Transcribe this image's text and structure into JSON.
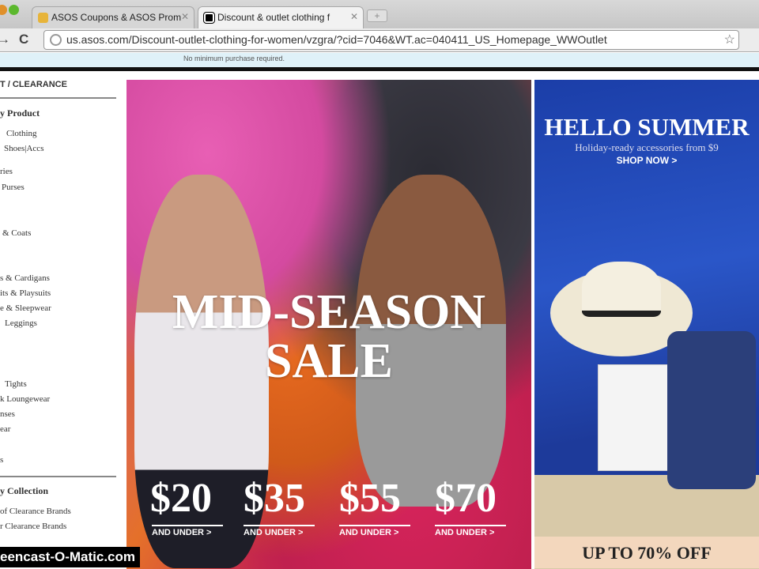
{
  "browser": {
    "tabs": [
      {
        "label": "ASOS Coupons & ASOS Prom",
        "active": false
      },
      {
        "label": "Discount & outlet clothing f",
        "active": true
      }
    ],
    "url": "us.asos.com/Discount-outlet-clothing-for-women/vzgra/?cid=7046&WT.ac=040411_US_Homepage_WWOutlet"
  },
  "notice": "No minimum purchase required.",
  "sidebar": {
    "title": "T / CLEARANCE",
    "section1": "y Product",
    "items": [
      "Clothing",
      "Shoes|Accs",
      "ries",
      "Purses",
      "& Coats",
      "s & Cardigans",
      "its & Playsuits",
      "e & Sleepwear",
      "Leggings",
      "Tights",
      "k Loungewear",
      "nses",
      "ear",
      "s"
    ],
    "section2": "y Collection",
    "collection": [
      "of Clearance Brands",
      "r Clearance Brands"
    ]
  },
  "hero": {
    "title_line1": "MID-SEASON",
    "title_line2": "SALE",
    "prices": [
      {
        "price": "$20",
        "link": "AND UNDER >"
      },
      {
        "price": "$35",
        "link": "AND UNDER >"
      },
      {
        "price": "$55",
        "link": "AND UNDER >"
      },
      {
        "price": "$70",
        "link": "AND UNDER >"
      }
    ]
  },
  "promo": {
    "title": "HELLO SUMMER",
    "subtitle": "Holiday-ready accessories from $9",
    "cta": "SHOP NOW >",
    "bottom": "UP TO 70% OFF"
  },
  "watermark": "eencast-O-Matic.com"
}
